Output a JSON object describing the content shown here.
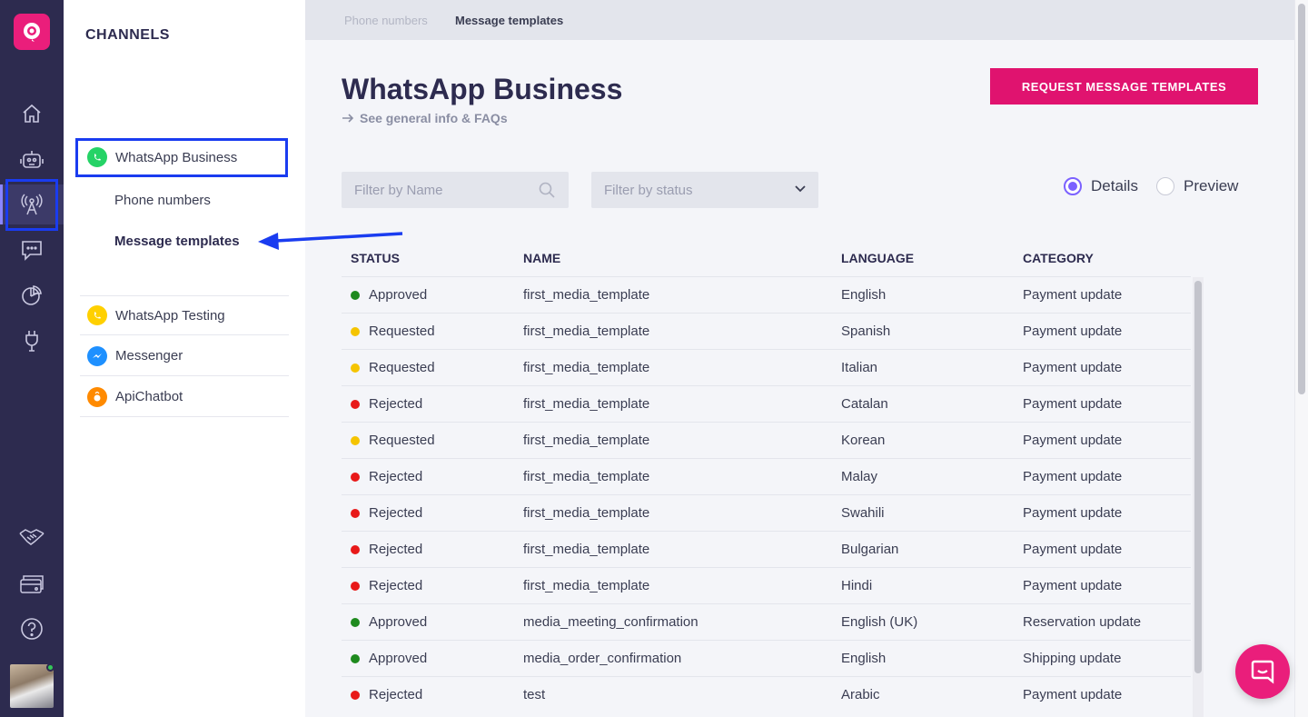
{
  "sidebar_heading": "CHANNELS",
  "channels": {
    "selected": "WhatsApp Business",
    "sub_items": [
      "Phone numbers",
      "Message templates"
    ],
    "others": [
      "WhatsApp Testing",
      "Messenger",
      "ApiChatbot"
    ]
  },
  "breadcrumb": [
    "Phone numbers",
    "Message templates"
  ],
  "page_title": "WhatsApp Business",
  "faq_link": "See general info & FAQs",
  "request_button": "REQUEST MESSAGE TEMPLATES",
  "filters": {
    "name_placeholder": "Filter by Name",
    "status_placeholder": "Filter by status"
  },
  "view_toggle": {
    "details": "Details",
    "preview": "Preview",
    "selected": "Details"
  },
  "table": {
    "headers": [
      "STATUS",
      "NAME",
      "LANGUAGE",
      "CATEGORY"
    ],
    "rows": [
      {
        "status": "Approved",
        "name": "first_media_template",
        "language": "English",
        "category": "Payment update"
      },
      {
        "status": "Requested",
        "name": "first_media_template",
        "language": "Spanish",
        "category": "Payment update"
      },
      {
        "status": "Requested",
        "name": "first_media_template",
        "language": "Italian",
        "category": "Payment update"
      },
      {
        "status": "Rejected",
        "name": "first_media_template",
        "language": "Catalan",
        "category": "Payment update"
      },
      {
        "status": "Requested",
        "name": "first_media_template",
        "language": "Korean",
        "category": "Payment update"
      },
      {
        "status": "Rejected",
        "name": "first_media_template",
        "language": "Malay",
        "category": "Payment update"
      },
      {
        "status": "Rejected",
        "name": "first_media_template",
        "language": "Swahili",
        "category": "Payment update"
      },
      {
        "status": "Rejected",
        "name": "first_media_template",
        "language": "Bulgarian",
        "category": "Payment update"
      },
      {
        "status": "Rejected",
        "name": "first_media_template",
        "language": "Hindi",
        "category": "Payment update"
      },
      {
        "status": "Approved",
        "name": "media_meeting_confirmation",
        "language": "English (UK)",
        "category": "Reservation update"
      },
      {
        "status": "Approved",
        "name": "media_order_confirmation",
        "language": "English",
        "category": "Shipping update"
      },
      {
        "status": "Rejected",
        "name": "test",
        "language": "Arabic",
        "category": "Payment update"
      }
    ]
  },
  "status_colors": {
    "Approved": "#1e8a1e",
    "Requested": "#f5c400",
    "Rejected": "#e81919"
  },
  "brand_color": "#e0136f",
  "rail_icons": [
    "home-icon",
    "bot-icon",
    "antenna-icon",
    "chat-icon",
    "analytics-icon",
    "plug-icon",
    "handshake-icon",
    "billing-icon",
    "help-icon"
  ]
}
